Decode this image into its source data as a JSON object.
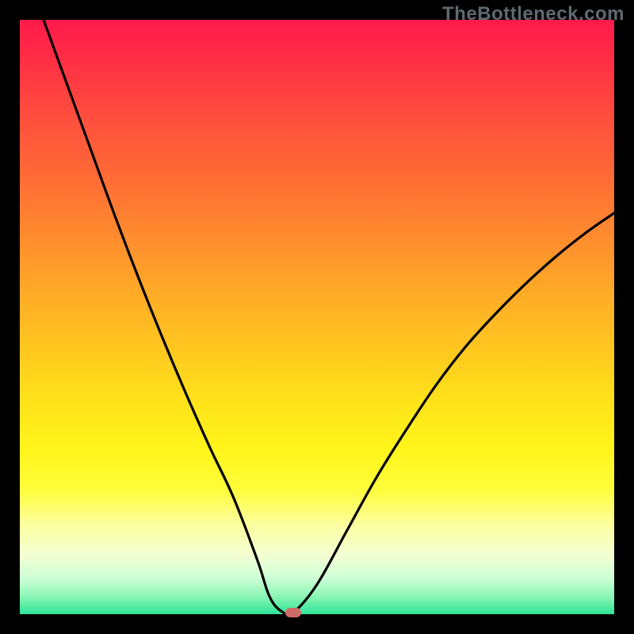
{
  "watermark": "TheBottleneck.com",
  "colors": {
    "background": "#000000",
    "curve": "#000000",
    "marker": "#cf6b65",
    "watermark": "#5e6a71"
  },
  "chart_data": {
    "type": "line",
    "title": "",
    "xlabel": "",
    "ylabel": "",
    "xlim": [
      0,
      100
    ],
    "ylim": [
      0,
      100
    ],
    "grid": false,
    "note": "V-shaped bottleneck curve. Left branch descends from top-left to a flat minimum near x≈42–46; right branch rises toward upper-right. Marker at the minimum.",
    "series": [
      {
        "name": "left-branch",
        "x": [
          4,
          8,
          12,
          16,
          20,
          24,
          28,
          32,
          36,
          40,
          42,
          44,
          46
        ],
        "values": [
          100,
          89,
          78,
          67,
          56.5,
          46.5,
          37,
          28,
          19.5,
          9,
          3,
          0.5,
          0.3
        ]
      },
      {
        "name": "right-branch",
        "x": [
          46,
          50,
          55,
          60,
          65,
          70,
          75,
          80,
          85,
          90,
          95,
          100
        ],
        "values": [
          0.3,
          5,
          14,
          23,
          31,
          38.5,
          45,
          50.5,
          55.5,
          60,
          64,
          67.5
        ]
      }
    ],
    "marker": {
      "x": 46,
      "y": 0.3
    }
  }
}
